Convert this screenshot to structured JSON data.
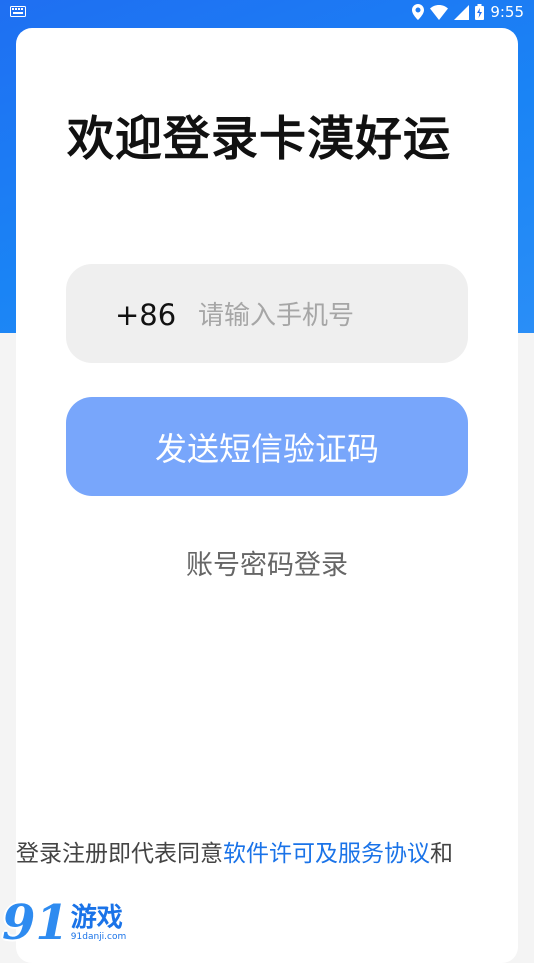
{
  "status_bar": {
    "time": "9:55",
    "icons": [
      "keyboard-icon",
      "location-icon",
      "wifi-icon",
      "signal-icon",
      "battery-icon"
    ]
  },
  "login": {
    "title": "欢迎登录卡漠好运",
    "country_code": "+86",
    "phone_placeholder": "请输入手机号",
    "phone_value": "",
    "send_code_button": "发送短信验证码",
    "password_login_link": "账号密码登录"
  },
  "agreement": {
    "prefix": "登录注册即代表同意",
    "link": "软件许可及服务协议",
    "suffix": "和"
  },
  "watermark": {
    "logo_number": "91",
    "logo_text": "游戏",
    "url": "91danji.com"
  },
  "colors": {
    "header_blue": "#1f6ff2",
    "button_blue": "#78a6fb",
    "link_blue": "#1a73e8",
    "input_bg": "#efefef"
  }
}
